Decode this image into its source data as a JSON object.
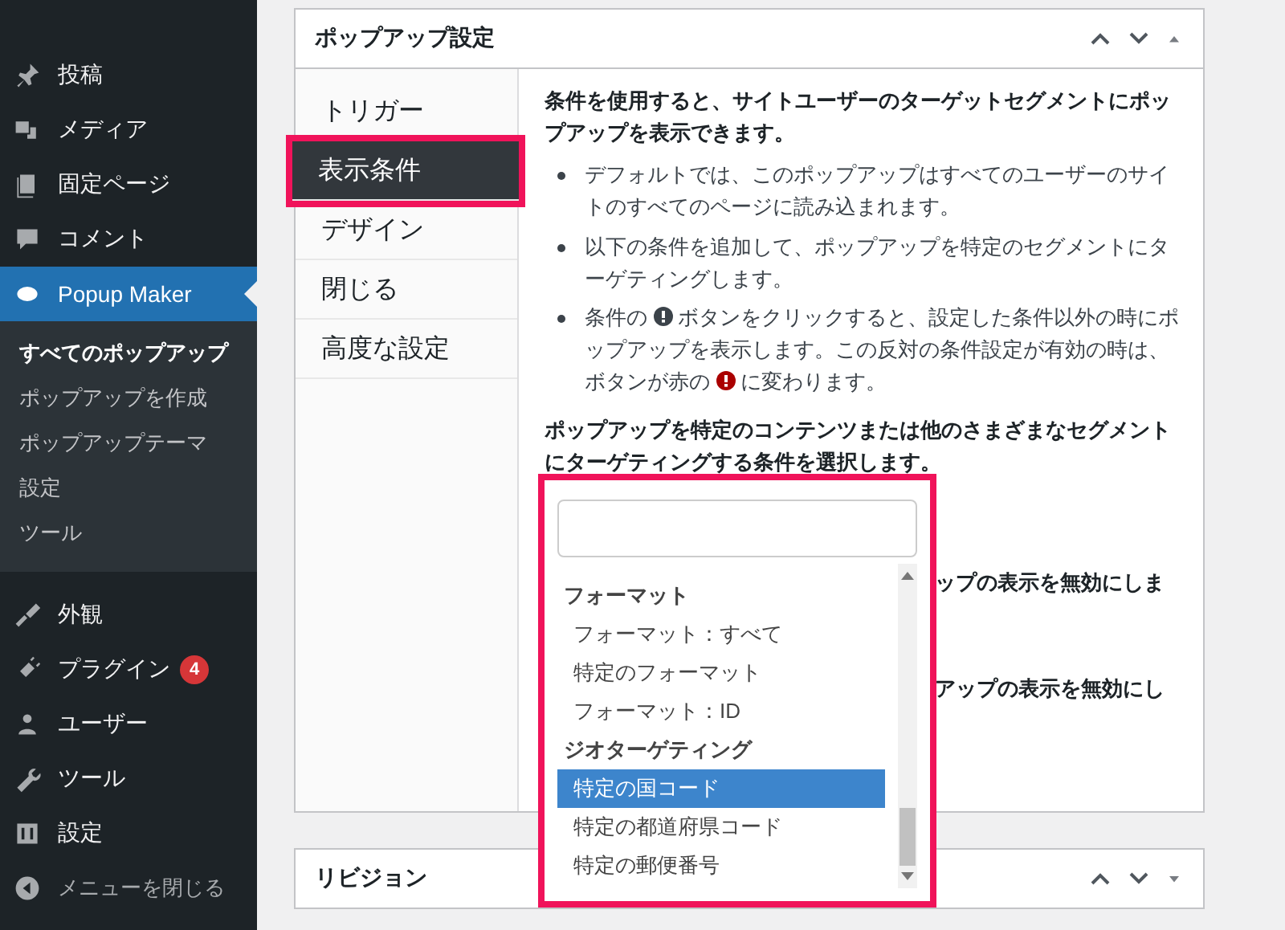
{
  "sidebar": {
    "items": [
      {
        "label": "投稿",
        "selected": false
      },
      {
        "label": "メディア",
        "selected": false
      },
      {
        "label": "固定ページ",
        "selected": false
      },
      {
        "label": "コメント",
        "selected": false
      },
      {
        "label": "Popup Maker",
        "selected": true,
        "submenu": [
          {
            "label": "すべてのポップアップ",
            "selected": true
          },
          {
            "label": "ポップアップを作成",
            "selected": false
          },
          {
            "label": "ポップアップテーマ",
            "selected": false
          },
          {
            "label": "設定",
            "selected": false
          },
          {
            "label": "ツール",
            "selected": false
          }
        ]
      },
      {
        "label": "外観",
        "selected": false
      },
      {
        "label": "プラグイン",
        "selected": false,
        "badge": "4"
      },
      {
        "label": "ユーザー",
        "selected": false
      },
      {
        "label": "ツール",
        "selected": false
      },
      {
        "label": "設定",
        "selected": false
      },
      {
        "label": "メニューを閉じる",
        "selected": false
      }
    ]
  },
  "settings_panel": {
    "title": "ポップアップ設定",
    "tabs": [
      {
        "label": "トリガー",
        "selected": false,
        "highlighted": false
      },
      {
        "label": "表示条件",
        "selected": true,
        "highlighted": true
      },
      {
        "label": "デザイン",
        "selected": false,
        "highlighted": false
      },
      {
        "label": "閉じる",
        "selected": false,
        "highlighted": false
      },
      {
        "label": "高度な設定",
        "selected": false,
        "highlighted": false
      }
    ],
    "intro": "条件を使用すると、サイトユーザーのターゲットセグメントにポップアップを表示できます。",
    "bullets": [
      {
        "parts": [
          {
            "kind": "text",
            "text": "デフォルトでは、このポップアップはすべてのユーザーのサイトのすべてのページに読み込まれます。"
          }
        ]
      },
      {
        "parts": [
          {
            "kind": "text",
            "text": "以下の条件を追加して、ポップアップを特定のセグメントにターゲティングします。"
          }
        ]
      },
      {
        "parts": [
          {
            "kind": "text",
            "text": "条件の "
          },
          {
            "kind": "icon",
            "active": false
          },
          {
            "kind": "text",
            "text": " ボタンをクリックすると、設定した条件以外の時にポップアップを表示します。この反対の条件設定が有効の時は、ボタンが赤の "
          },
          {
            "kind": "icon",
            "active": true
          },
          {
            "kind": "text",
            "text": " に変わります。"
          }
        ]
      }
    ],
    "prompt": "ポップアップを特定のコンテンツまたは他のさまざまなセグメントにターゲティングする条件を選択します。",
    "hidden_lines": [
      "ップの表示を無効にしま",
      "アップの表示を無効にし"
    ]
  },
  "condition_dropdown": {
    "highlighted": true,
    "groups": [
      {
        "label": "フォーマット",
        "options": [
          {
            "label": "フォーマット：すべて",
            "selected": false
          },
          {
            "label": "特定のフォーマット",
            "selected": false
          },
          {
            "label": "フォーマット：ID",
            "selected": false
          }
        ]
      },
      {
        "label": "ジオターゲティング",
        "options": [
          {
            "label": "特定の国コード",
            "selected": true
          },
          {
            "label": "特定の都道府県コード",
            "selected": false
          },
          {
            "label": "特定の郵便番号",
            "selected": false
          }
        ]
      }
    ]
  },
  "revisions_panel": {
    "title": "リビジョン"
  }
}
